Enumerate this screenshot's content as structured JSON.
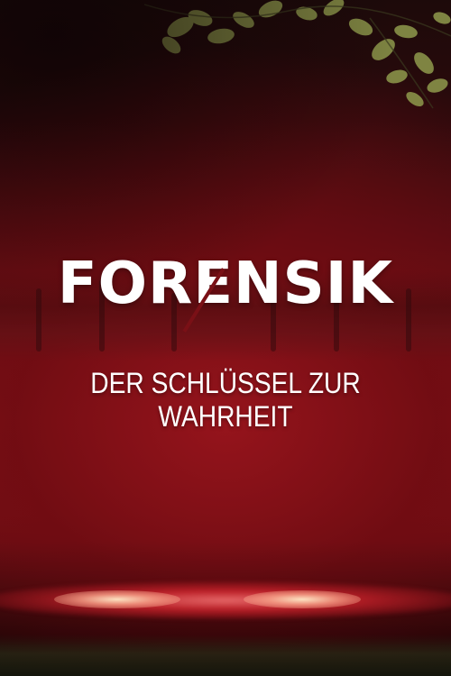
{
  "poster": {
    "title": "FORENSIK",
    "subtitle": "DER SCHLÜSSEL ZUR WAHRHEIT"
  },
  "colors": {
    "background_red": "#8a1219",
    "dark_red": "#2b0a0c",
    "title_text": "#ffffff",
    "ground_glow": "#ff6b6b",
    "leaves": "#9aa654"
  }
}
